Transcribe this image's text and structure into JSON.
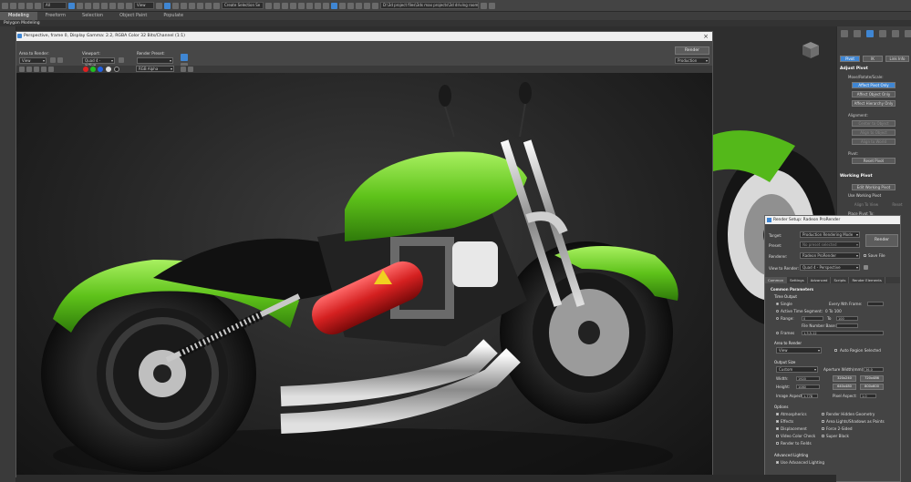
{
  "toolbar": {
    "filter_all": "All",
    "ref_coord": "View",
    "selection_set": "Create Selection Se",
    "project_path": "D:\\3d project files\\3ds max projects\\3d driving room"
  },
  "ribbon": {
    "tabs": [
      "Modeling",
      "Freeform",
      "Selection",
      "Object Paint",
      "Populate"
    ],
    "sub": "Polygon Modeling"
  },
  "frame": {
    "title": "Perspective, frame 0, Display Gamma: 2.2, RGBA Color 32 Bits/Channel (1:1)",
    "area_label": "Area to Render:",
    "area_value": "View",
    "viewport_label": "Viewport:",
    "viewport_value": "Quad 4 - active",
    "preset_label": "Render Preset:",
    "preset_value": "",
    "render_button": "Render",
    "render_mode": "Production",
    "channel": "RGB Alpha"
  },
  "rsd": {
    "title": "Render Setup: Radeon ProRender",
    "target_label": "Target:",
    "target_value": "Production Rendering Mode",
    "preset_label": "Preset:",
    "preset_value": "No preset selected",
    "renderer_label": "Renderer:",
    "renderer_value": "Radeon ProRender",
    "save_file": "Save File",
    "view_label": "View to Render:",
    "view_value": "Quad 4 - Perspective",
    "render_button": "Render",
    "tabs": [
      "Common",
      "Settings",
      "Advanced",
      "Scripts",
      "Render Elements"
    ],
    "common_params": "Common Parameters",
    "time_output": "Time Output",
    "single": "Single",
    "every_nth": "Every Nth Frame:",
    "active_segment": "Active Time Segment:",
    "active_range": "0 To 100",
    "range": "Range:",
    "range_from": "0",
    "range_to_label": "To",
    "range_to": "100",
    "file_number_base": "File Number Base:",
    "frames": "Frames",
    "frames_value": "1,3,5-12",
    "area_to_render": "Area to Render",
    "area_value": "View",
    "auto_region": "Auto Region Selected",
    "output_size": "Output Size",
    "output_custom": "Custom",
    "aperture_label": "Aperture Width(mm):",
    "aperture_value": "36.0",
    "width_label": "Width:",
    "width_value": "1920",
    "height_label": "Height:",
    "height_value": "1080",
    "size_presets": [
      "320x240",
      "720x486",
      "640x480",
      "800x600"
    ],
    "image_aspect_label": "Image Aspect:",
    "image_aspect_value": "1.778",
    "pixel_aspect_label": "Pixel Aspect:",
    "pixel_aspect_value": "1.0",
    "options": "Options",
    "opt_left": [
      "Atmospherics",
      "Effects",
      "Displacement",
      "Video Color Check",
      "Render to Fields"
    ],
    "opt_right": [
      "Render Hidden Geometry",
      "Area Lights/Shadows as Points",
      "Force 2-Sided",
      "Super Black"
    ],
    "advanced_lighting": "Advanced Lighting",
    "use_advanced": "Use Advanced Lighting"
  },
  "cmd": {
    "tabs": [
      "Pivot",
      "IK",
      "Link Info"
    ],
    "adjust_pivot": "Adjust Pivot",
    "move_rotate": "Move/Rotate/Scale:",
    "affect_pivot": "Affect Pivot Only",
    "affect_object": "Affect Object Only",
    "affect_hierarchy": "Affect Hierarchy Only",
    "alignment": "Alignment:",
    "center": "Center to Object",
    "align_object": "Align to Object",
    "align_world": "Align to World",
    "pivot": "Pivot:",
    "reset_pivot": "Reset Pivot",
    "working_pivot": "Working Pivot",
    "edit_working": "Edit Working Pivot",
    "use_working": "Use Working Pivot",
    "align_view": "Align To View",
    "reset": "Reset",
    "place_pivot": "Place Pivot To:"
  },
  "colors": {
    "accent": "#3f86d3",
    "bike_green": "#5ec21a",
    "extinguisher": "#d42020"
  }
}
